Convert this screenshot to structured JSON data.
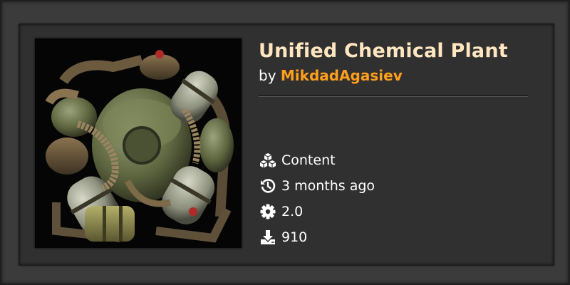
{
  "mod": {
    "title": "Unified Chemical Plant",
    "by_prefix": "by",
    "author": "MikdadAgasiev"
  },
  "meta": [
    {
      "icon": "cubes-icon",
      "text": "Content"
    },
    {
      "icon": "history-icon",
      "text": "3 months ago"
    },
    {
      "icon": "gear-icon",
      "text": "2.0"
    },
    {
      "icon": "download-icon",
      "text": "910"
    }
  ],
  "colors": {
    "title": "#ffe6c0",
    "author": "#ff9f1c",
    "text": "#ffffff",
    "card_bg": "#303030"
  }
}
